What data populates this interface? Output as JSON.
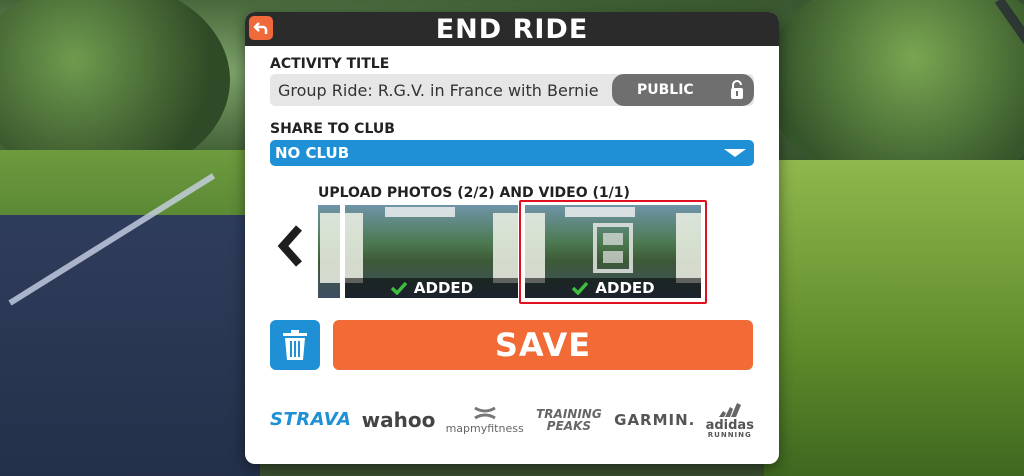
{
  "dialog": {
    "title": "END RIDE",
    "activity_title_label": "ACTIVITY TITLE",
    "activity_title_value": "Group Ride: R.G.V. in France with Bernie",
    "visibility_label": "PUBLIC",
    "share_label": "SHARE TO CLUB",
    "club_value": "NO CLUB",
    "upload_label": "UPLOAD PHOTOS (2/2) AND VIDEO (1/1)",
    "thumbnails": [
      {
        "status": "ADDED"
      },
      {
        "status": "ADDED"
      }
    ],
    "save_label": "SAVE"
  },
  "partners": {
    "strava": "STRAVA",
    "wahoo": "wahoo",
    "mapmyfitness": "mapmyfitness",
    "trainingpeaks": "TRAINING PEAKS",
    "garmin": "GARMIN.",
    "adidas": "adidas",
    "adidas_sub": "RUNNING"
  },
  "colors": {
    "accent_orange": "#f26a36",
    "accent_blue": "#1f90d6",
    "header_dark": "#2b2b2b",
    "selection_red": "#e01020"
  }
}
